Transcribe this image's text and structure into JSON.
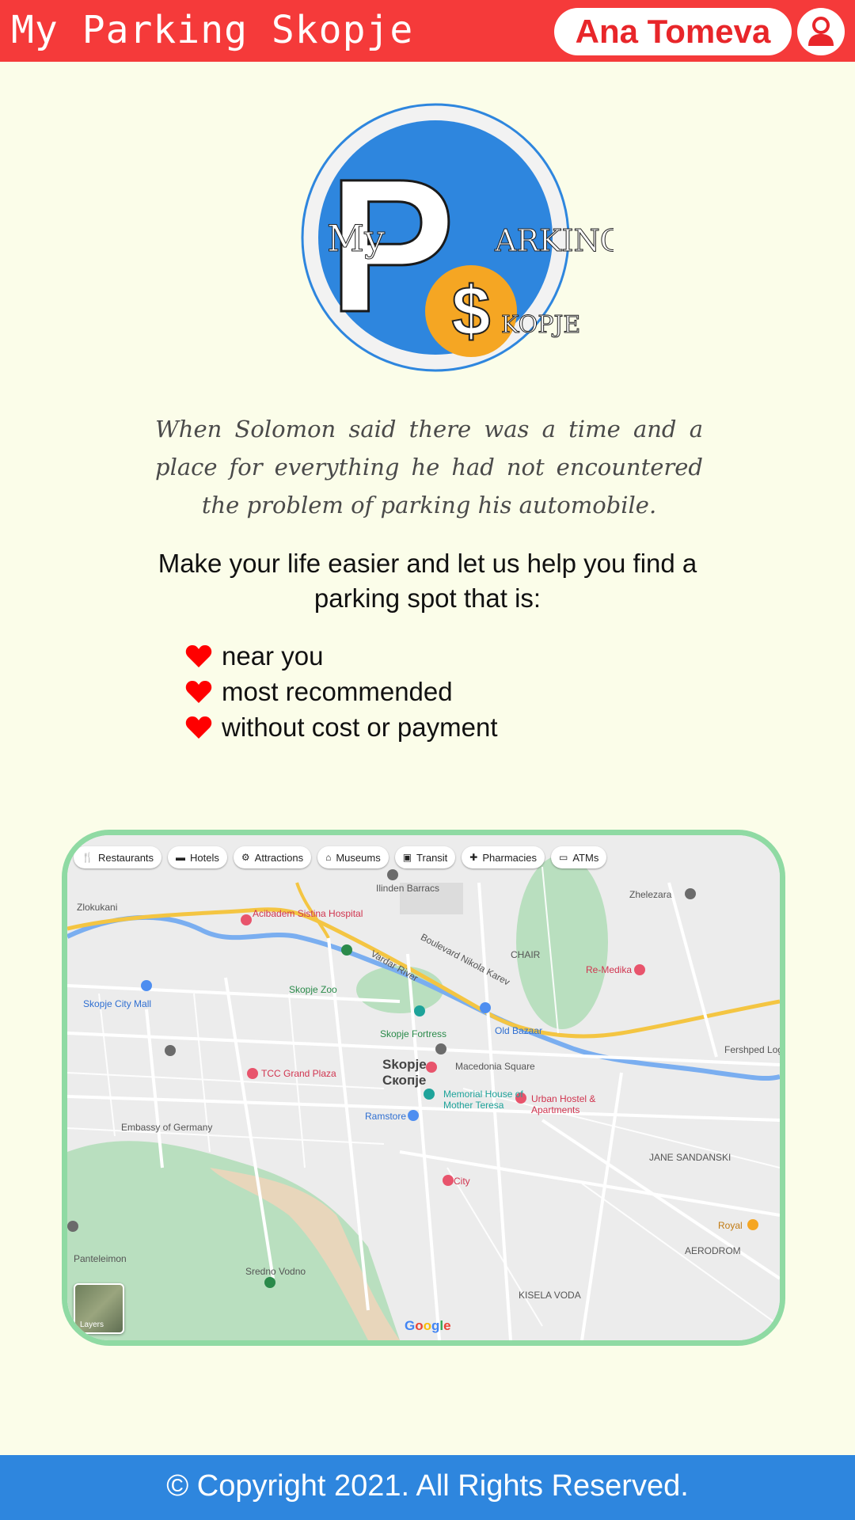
{
  "header": {
    "app_title": "My Parking Skopje",
    "user_name": "Ana Tomeva",
    "user_icon": "user-icon"
  },
  "logo": {
    "word_my": "My",
    "letter_p": "P",
    "word_arking": "ARKING",
    "letter_s": "$",
    "word_kopje": "KOPJE"
  },
  "main": {
    "quote": "When Solomon said there was a time and a place for everything he had not encountered the problem of parking his automobile.",
    "intro": "Make your life easier and let us help you find a parking spot that is:",
    "features": [
      "near you",
      "most recommended",
      "without cost or payment"
    ],
    "feature_icon": "heart-icon"
  },
  "map": {
    "chips": [
      {
        "label": "Restaurants",
        "icon": "restaurant-icon"
      },
      {
        "label": "Hotels",
        "icon": "hotel-icon"
      },
      {
        "label": "Attractions",
        "icon": "attractions-icon"
      },
      {
        "label": "Museums",
        "icon": "museum-icon"
      },
      {
        "label": "Transit",
        "icon": "transit-icon"
      },
      {
        "label": "Pharmacies",
        "icon": "pharmacy-icon"
      },
      {
        "label": "ATMs",
        "icon": "atm-icon"
      }
    ],
    "labels": {
      "city": "Skopje",
      "city_cyr": "Скопје",
      "zoo": "Skopje Zoo",
      "fortress": "Skopje Fortress",
      "bazaar": "Old Bazaar",
      "square": "Macedonia Square",
      "city_mall": "Skopje City Mall",
      "tcc": "TCC Grand Plaza",
      "memorial": "Memorial House of Mother Teresa",
      "urban_hostel": "Urban Hostel & Apartments",
      "ramstore": "Ramstore",
      "embassy": "Embassy of Germany",
      "acibadem": "Acibadem Sistina Hospital",
      "ilinden": "Ilinden Barracs",
      "zhelezara": "Zhelezara",
      "re_medika": "Re-Medika",
      "chair": "CHAIR",
      "jane": "JANE SANDANSKI",
      "aerodrom": "AERODROM",
      "kisela_voda": "KISELA VODA",
      "sredno_vodno": "Sredno Vodno",
      "panteleimon": "Panteleimon",
      "zlokukani": "Zlokukani",
      "royal": "Royal",
      "city_place": "City",
      "fershped": "Fershped Logistichki Centar",
      "vardar": "Vardar River",
      "blvd": "Boulevard Nikola Karev",
      "layers": "Layers",
      "google": "Google"
    },
    "colors": {
      "frame": "#8fdaa3",
      "river": "#7aaef0",
      "highway": "#f4c542",
      "park": "#b9dfbf"
    }
  },
  "footer": {
    "copyright": "© Copyright 2021. All Rights Reserved."
  },
  "colors": {
    "header_bg": "#f53a3a",
    "page_bg": "#fbfde9",
    "footer_bg": "#2e86de",
    "logo_blue": "#2e86de",
    "logo_orange": "#f5a623",
    "heart_red": "#ff0000"
  }
}
